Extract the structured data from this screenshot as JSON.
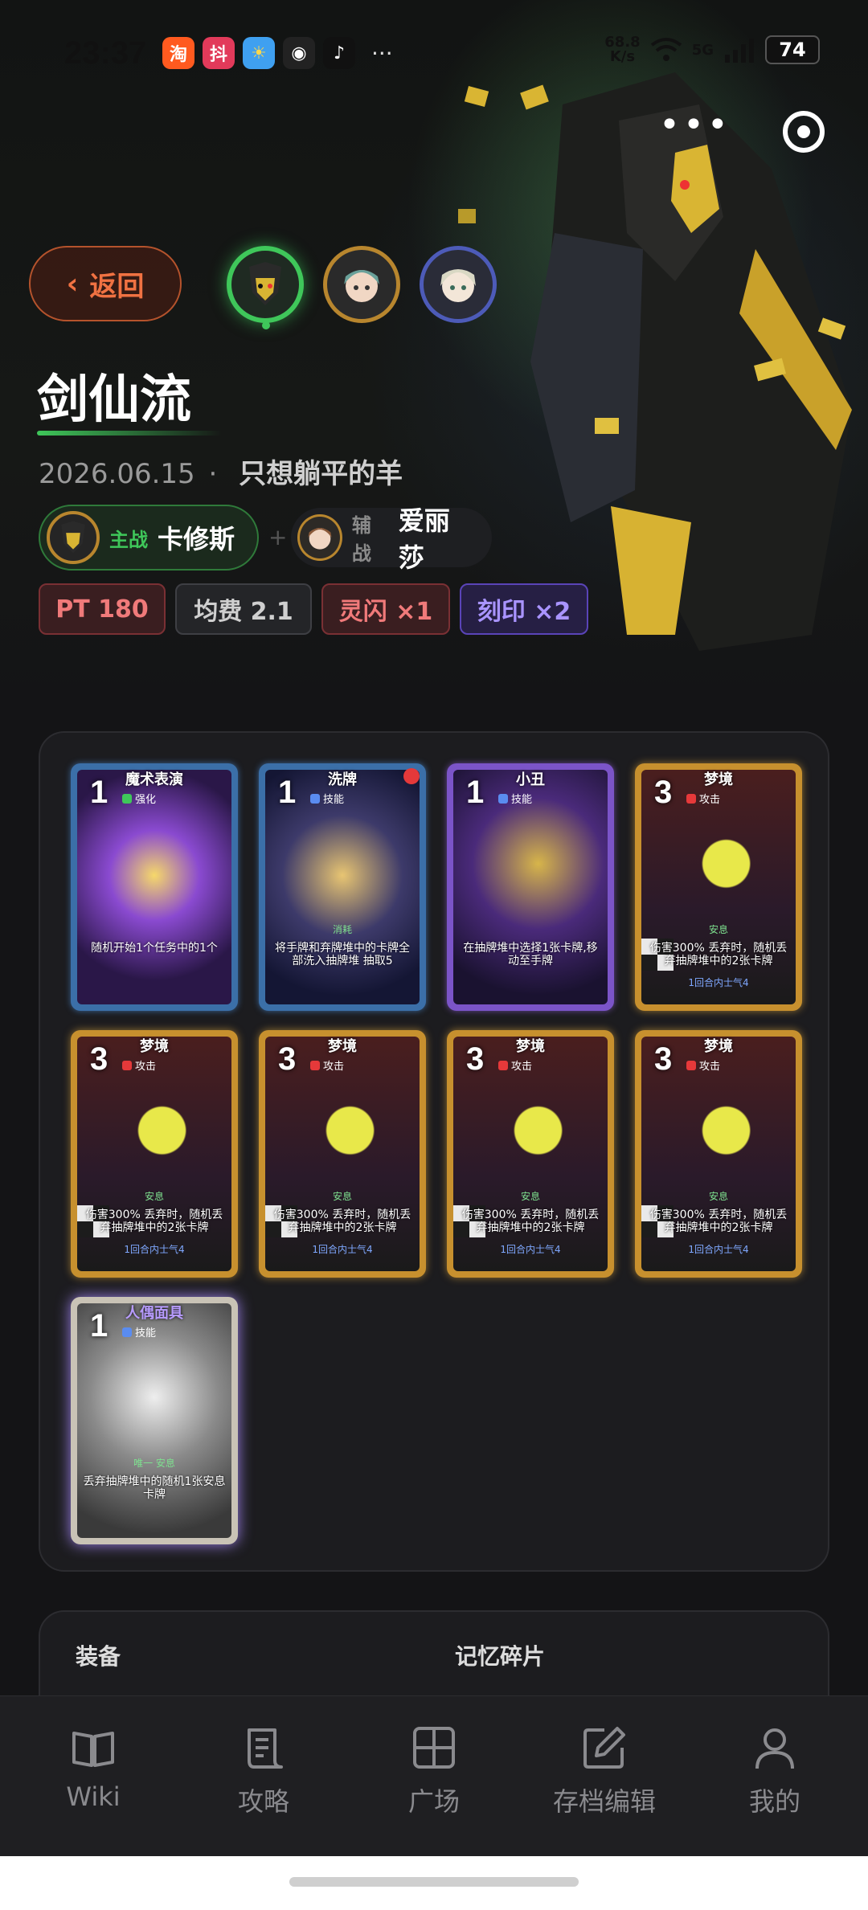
{
  "status_bar": {
    "time": "23:37",
    "apps": [
      "淘",
      "抖",
      "☀",
      "◉",
      "♪"
    ],
    "more": "···",
    "net_speed": "68.8",
    "net_unit": "K/s",
    "signal": "5G",
    "battery": "74"
  },
  "header": {
    "back_label": "返回",
    "more_label": "•••"
  },
  "deck": {
    "title": "剑仙流",
    "date": "2026.06.15",
    "separator": "·",
    "author": "只想躺平的羊",
    "main_role_tag": "主战",
    "main_role_name": "卡修斯",
    "plus": "+",
    "sub_role_tag": "辅战",
    "sub_role_name": "爱丽莎",
    "tags": [
      "PT 180",
      "均费 2.1",
      "灵闪 ×1",
      "刻印 ×2"
    ]
  },
  "cards": [
    {
      "name": "魔术表演",
      "cost": "1",
      "type": "强化",
      "desc": "随机开始1个任务中的1个",
      "keyword": "",
      "foot": ""
    },
    {
      "name": "洗牌",
      "cost": "1",
      "type": "技能",
      "desc": "将手牌和弃牌堆中的卡牌全部洗入抽牌堆 抽取5",
      "keyword": "消耗",
      "foot": ""
    },
    {
      "name": "小丑",
      "cost": "1",
      "type": "技能",
      "desc": "在抽牌堆中选择1张卡牌,移动至手牌",
      "keyword": "",
      "foot": ""
    },
    {
      "name": "梦境",
      "cost": "3",
      "type": "攻击",
      "desc": "伤害300% 丢弃时，随机丢弃抽牌堆中的2张卡牌",
      "keyword": "安息",
      "foot": "1回合内士气4"
    },
    {
      "name": "梦境",
      "cost": "3",
      "type": "攻击",
      "desc": "伤害300% 丢弃时，随机丢弃抽牌堆中的2张卡牌",
      "keyword": "安息",
      "foot": "1回合内士气4"
    },
    {
      "name": "梦境",
      "cost": "3",
      "type": "攻击",
      "desc": "伤害300% 丢弃时，随机丢弃抽牌堆中的2张卡牌",
      "keyword": "安息",
      "foot": "1回合内士气4"
    },
    {
      "name": "梦境",
      "cost": "3",
      "type": "攻击",
      "desc": "伤害300% 丢弃时，随机丢弃抽牌堆中的2张卡牌",
      "keyword": "安息",
      "foot": "1回合内士气4"
    },
    {
      "name": "梦境",
      "cost": "3",
      "type": "攻击",
      "desc": "伤害300% 丢弃时，随机丢弃抽牌堆中的2张卡牌",
      "keyword": "安息",
      "foot": "1回合内士气4"
    },
    {
      "name": "人偶面具",
      "cost": "1",
      "type": "技能",
      "desc": "丢弃抽牌堆中的随机1张安息卡牌",
      "keyword": "唯一   安息",
      "foot": ""
    }
  ],
  "sections": {
    "equipment": "装备",
    "memory": "记忆碎片"
  },
  "nav": [
    {
      "label": "Wiki",
      "icon": "book-icon"
    },
    {
      "label": "攻略",
      "icon": "scroll-icon"
    },
    {
      "label": "广场",
      "icon": "grid-icon"
    },
    {
      "label": "存档编辑",
      "icon": "edit-icon"
    },
    {
      "label": "我的",
      "icon": "user-icon"
    }
  ],
  "colors": {
    "accent_green": "#3fc75a",
    "accent_orange": "#f07242",
    "tag_red": "#f07a7a",
    "tag_purple": "#a994ff"
  }
}
